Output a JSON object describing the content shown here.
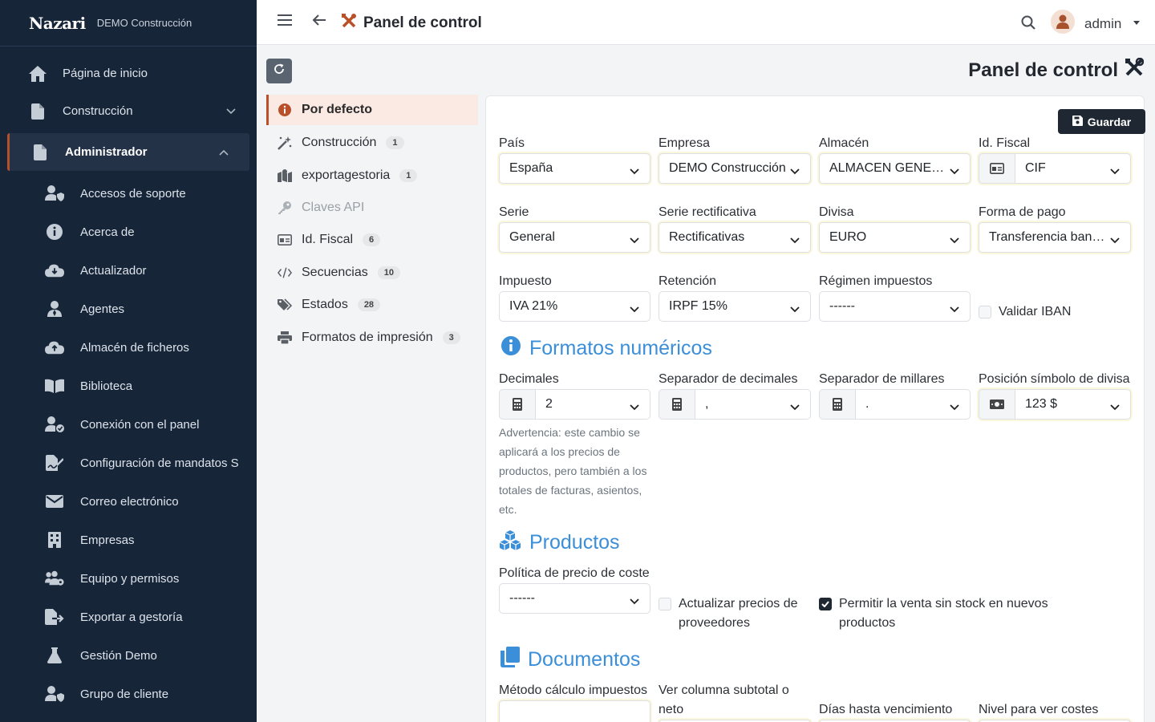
{
  "brand": {
    "logo": "Nazari",
    "company": "DEMO Construcción"
  },
  "sidebar": {
    "top_items": [
      {
        "label": "Página de inicio",
        "icon": "home-icon"
      },
      {
        "label": "Construcción",
        "icon": "file-icon"
      }
    ],
    "active_item": {
      "label": "Administrador",
      "icon": "file-icon"
    },
    "sub_items": [
      {
        "label": "Accesos de soporte",
        "icon": "user-shield-icon"
      },
      {
        "label": "Acerca de",
        "icon": "info-circle-icon"
      },
      {
        "label": "Actualizador",
        "icon": "cloud-download-icon"
      },
      {
        "label": "Agentes",
        "icon": "user-tie-icon"
      },
      {
        "label": "Almacén de ficheros",
        "icon": "cloud-upload-icon"
      },
      {
        "label": "Biblioteca",
        "icon": "book-open-icon"
      },
      {
        "label": "Conexión con el panel",
        "icon": "user-check-icon"
      },
      {
        "label": "Configuración de mandatos S",
        "icon": "file-signature-icon"
      },
      {
        "label": "Correo electrónico",
        "icon": "envelope-icon"
      },
      {
        "label": "Empresas",
        "icon": "building-icon"
      },
      {
        "label": "Equipo y permisos",
        "icon": "users-cog-icon"
      },
      {
        "label": "Exportar a gestoría",
        "icon": "file-export-icon"
      },
      {
        "label": "Gestión Demo",
        "icon": "flask-icon"
      },
      {
        "label": "Grupo de cliente",
        "icon": "user-shield-icon"
      }
    ]
  },
  "topbar": {
    "title": "Panel de control",
    "user": "admin"
  },
  "page": {
    "title": "Panel de control"
  },
  "subnav": [
    {
      "label": "Por defecto",
      "badge": "",
      "icon": "info-circle-icon"
    },
    {
      "label": "Construcción",
      "badge": "1",
      "icon": "magic-wand-icon"
    },
    {
      "label": "exportagestoria",
      "badge": "1",
      "icon": "map-marked-icon"
    },
    {
      "label": "Claves API",
      "badge": "",
      "icon": "key-icon"
    },
    {
      "label": "Id. Fiscal",
      "badge": "6",
      "icon": "id-card-icon"
    },
    {
      "label": "Secuencias",
      "badge": "10",
      "icon": "code-icon"
    },
    {
      "label": "Estados",
      "badge": "28",
      "icon": "tags-icon"
    },
    {
      "label": "Formatos de impresión",
      "badge": "3",
      "icon": "print-icon"
    }
  ],
  "form": {
    "save_label": "Guardar",
    "pais": {
      "label": "País",
      "value": "España"
    },
    "empresa": {
      "label": "Empresa",
      "value": "DEMO Construcción"
    },
    "almacen": {
      "label": "Almacén",
      "value": "ALMACEN GENERAL"
    },
    "idfiscal": {
      "label": "Id. Fiscal",
      "value": "CIF"
    },
    "serie": {
      "label": "Serie",
      "value": "General"
    },
    "serie_rect": {
      "label": "Serie rectificativa",
      "value": "Rectificativas"
    },
    "divisa": {
      "label": "Divisa",
      "value": "EURO"
    },
    "forma_pago": {
      "label": "Forma de pago",
      "value": "Transferencia bancaria"
    },
    "impuesto": {
      "label": "Impuesto",
      "value": "IVA 21%"
    },
    "retencion": {
      "label": "Retención",
      "value": "IRPF 15%"
    },
    "regimen": {
      "label": "Régimen impuestos",
      "value": "------"
    },
    "validar_iban": {
      "label": "Validar IBAN",
      "checked": false
    },
    "sec_formatos": "Formatos numéricos",
    "decimales": {
      "label": "Decimales",
      "value": "2",
      "help": "Advertencia: este cambio se aplicará a los precios de productos, pero también a los totales de facturas, asientos, etc."
    },
    "sep_decimales": {
      "label": "Separador de decimales",
      "value": ","
    },
    "sep_millares": {
      "label": "Separador de millares",
      "value": "."
    },
    "pos_simbolo": {
      "label": "Posición símbolo de divisa",
      "value": "123 $"
    },
    "sec_productos": "Productos",
    "politica": {
      "label": "Política de precio de coste",
      "value": "------"
    },
    "act_precios": {
      "label": "Actualizar precios de proveedores",
      "checked": false
    },
    "permitir_venta": {
      "label": "Permitir la venta sin stock en nuevos productos",
      "checked": true
    },
    "sec_documentos": "Documentos",
    "metodo_calculo": {
      "label": "Método cálculo impuestos"
    },
    "ver_columna": {
      "label": "Ver columna subtotal o neto"
    },
    "dias_venc": {
      "label": "Días hasta vencimiento"
    },
    "nivel_costes": {
      "label": "Nivel para ver costes"
    }
  },
  "colors": {
    "sidebar_bg": "#172539",
    "accent": "#b9502a",
    "section_blue": "#3b8ed8",
    "dark_button": "#1f2733"
  }
}
